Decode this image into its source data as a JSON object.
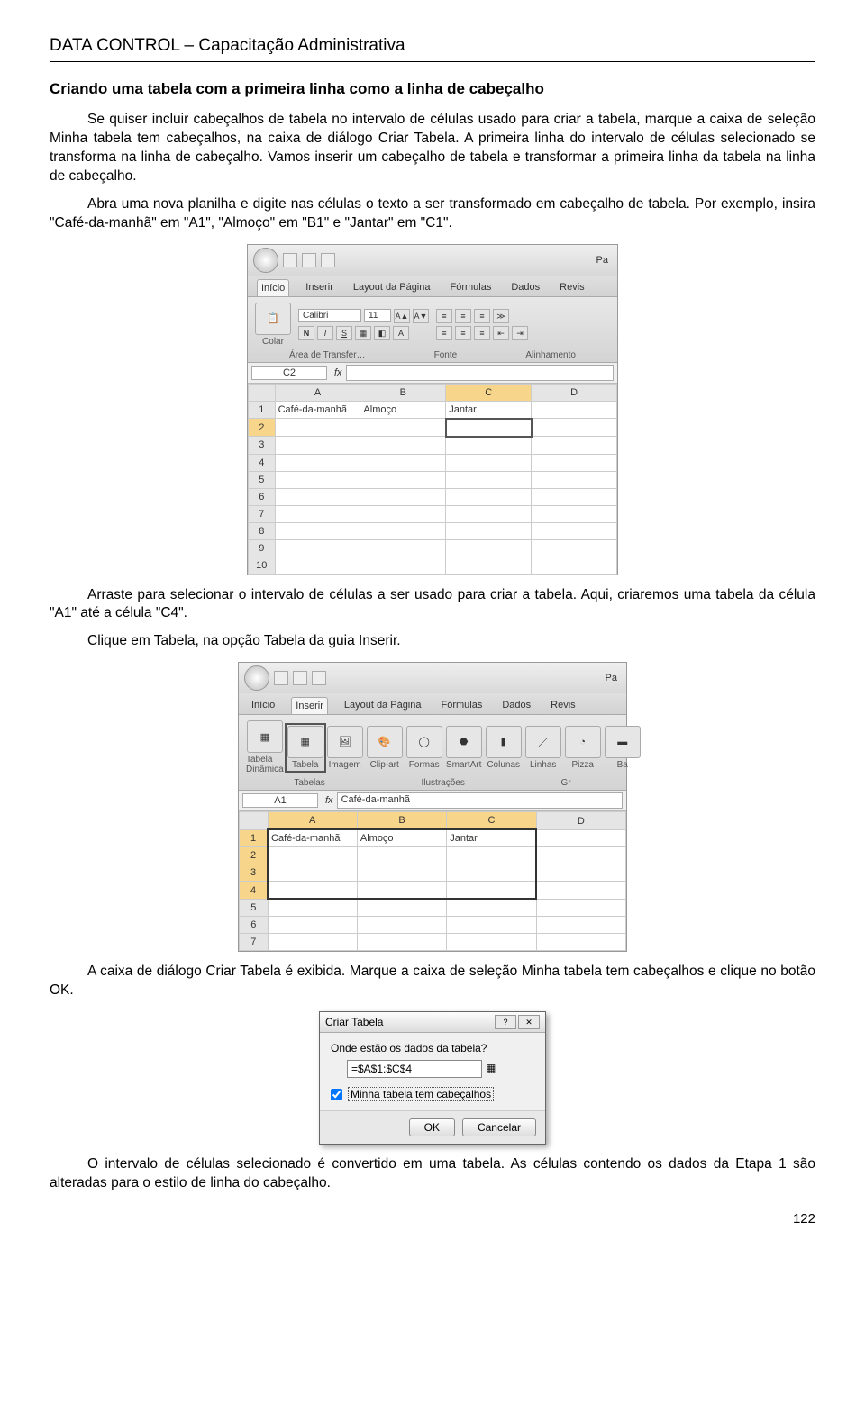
{
  "header": "DATA CONTROL – Capacitação Administrativa",
  "title": "Criando uma tabela com a primeira linha como a linha de cabeçalho",
  "p1": "Se quiser incluir cabeçalhos de tabela no intervalo de células usado para criar a tabela, marque a caixa de seleção Minha tabela tem cabeçalhos, na caixa de diálogo Criar Tabela. A primeira linha do intervalo de células selecionado se transforma na linha de cabeçalho. Vamos inserir um cabeçalho de tabela e transformar a primeira linha da tabela na linha de cabeçalho.",
  "p2": "Abra uma nova planilha e digite nas células o texto a ser transformado em cabeçalho de tabela. Por exemplo, insira \"Café-da-manhã\" em \"A1\", \"Almoço\" em \"B1\" e \"Jantar\" em \"C1\".",
  "p3": "Arraste para selecionar o intervalo de células a ser usado para criar a tabela. Aqui, criaremos uma tabela da célula \"A1\" até a célula \"C4\".",
  "p4": "Clique em Tabela, na opção Tabela da guia Inserir.",
  "p5": "A caixa de diálogo Criar Tabela é exibida. Marque a caixa de seleção Minha tabela tem cabeçalhos e clique no botão OK.",
  "p6": "O intervalo de células selecionado é convertido em uma tabela. As células contendo os dados da Etapa 1 são alteradas para o estilo de linha do cabeçalho.",
  "pageNum": "122",
  "excel": {
    "pa": "Pa",
    "tabs": {
      "inicio": "Início",
      "inserir": "Inserir",
      "layout": "Layout da Página",
      "formulas": "Fórmulas",
      "dados": "Dados",
      "revis": "Revis"
    },
    "font": {
      "name": "Calibri",
      "size": "11"
    },
    "buttons": {
      "colar": "Colar",
      "n": "N",
      "i": "I",
      "s": "S"
    },
    "groups": {
      "area": "Área de Transfer…",
      "fonte": "Fonte",
      "alin": "Alinhamento"
    },
    "namebox1": "C2",
    "fxval1": "",
    "namebox2": "A1",
    "fxval2": "Café-da-manhã",
    "cols": [
      "A",
      "B",
      "C",
      "D"
    ],
    "row1": {
      "a": "Café-da-manhã",
      "b": "Almoço",
      "c": "Jantar"
    },
    "inserirTab": {
      "tabelaDin": "Tabela Dinâmica",
      "tabela": "Tabela",
      "imagem": "Imagem",
      "clipart": "Clip-art",
      "formas": "Formas",
      "smartart": "SmartArt",
      "colunas": "Colunas",
      "linhas": "Linhas",
      "pizza": "Pizza",
      "ba": "Ba",
      "grpTabelas": "Tabelas",
      "grpIlu": "Ilustrações",
      "grpGr": "Gr"
    }
  },
  "dialog": {
    "title": "Criar Tabela",
    "prompt": "Onde estão os dados da tabela?",
    "range": "=$A$1:$C$4",
    "checkbox": "Minha tabela tem cabeçalhos",
    "ok": "OK",
    "cancel": "Cancelar"
  }
}
